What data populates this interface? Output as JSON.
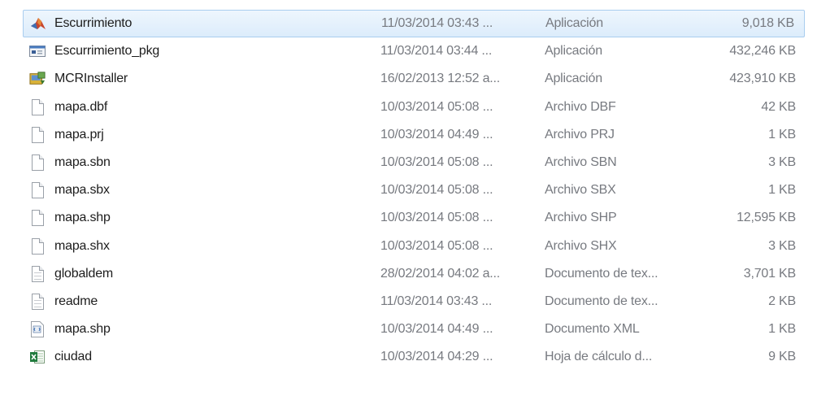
{
  "files": [
    {
      "name": "Escurrimiento",
      "date": "11/03/2014 03:43 ...",
      "type": "Aplicación",
      "size": "9,018 KB",
      "icon": "matlab-app-icon",
      "selected": true
    },
    {
      "name": "Escurrimiento_pkg",
      "date": "11/03/2014 03:44 ...",
      "type": "Aplicación",
      "size": "432,246 KB",
      "icon": "package-app-icon"
    },
    {
      "name": "MCRInstaller",
      "date": "16/02/2013 12:52 a...",
      "type": "Aplicación",
      "size": "423,910 KB",
      "icon": "installer-icon"
    },
    {
      "name": "mapa.dbf",
      "date": "10/03/2014 05:08 ...",
      "type": "Archivo DBF",
      "size": "42 KB",
      "icon": "blank-file-icon"
    },
    {
      "name": "mapa.prj",
      "date": "10/03/2014 04:49 ...",
      "type": "Archivo PRJ",
      "size": "1 KB",
      "icon": "blank-file-icon"
    },
    {
      "name": "mapa.sbn",
      "date": "10/03/2014 05:08 ...",
      "type": "Archivo SBN",
      "size": "3 KB",
      "icon": "blank-file-icon"
    },
    {
      "name": "mapa.sbx",
      "date": "10/03/2014 05:08 ...",
      "type": "Archivo SBX",
      "size": "1 KB",
      "icon": "blank-file-icon"
    },
    {
      "name": "mapa.shp",
      "date": "10/03/2014 05:08 ...",
      "type": "Archivo SHP",
      "size": "12,595 KB",
      "icon": "blank-file-icon"
    },
    {
      "name": "mapa.shx",
      "date": "10/03/2014 05:08 ...",
      "type": "Archivo SHX",
      "size": "3 KB",
      "icon": "blank-file-icon"
    },
    {
      "name": "globaldem",
      "date": "28/02/2014 04:02 a...",
      "type": "Documento de tex...",
      "size": "3,701 KB",
      "icon": "text-document-icon"
    },
    {
      "name": "readme",
      "date": "11/03/2014 03:43 ...",
      "type": "Documento de tex...",
      "size": "2 KB",
      "icon": "text-document-icon"
    },
    {
      "name": "mapa.shp",
      "date": "10/03/2014 04:49 ...",
      "type": "Documento XML",
      "size": "1 KB",
      "icon": "xml-document-icon"
    },
    {
      "name": "ciudad",
      "date": "10/03/2014 04:29 ...",
      "type": "Hoja de cálculo d...",
      "size": "9 KB",
      "icon": "excel-spreadsheet-icon"
    }
  ],
  "colors": {
    "selection_bg": "#dcecfb",
    "selection_border": "#a9cdef",
    "secondary_text": "#777a80",
    "primary_text": "#1d1d1d"
  }
}
